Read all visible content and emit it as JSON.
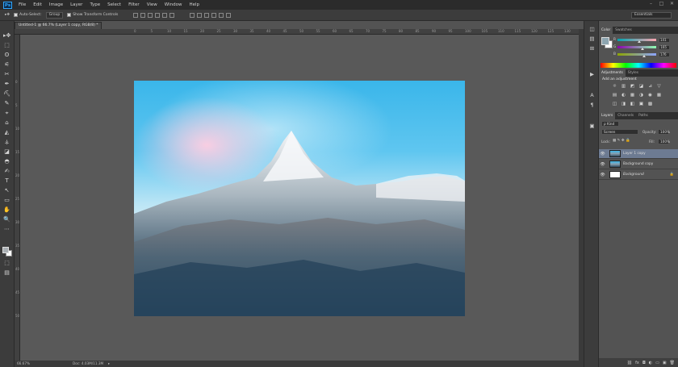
{
  "app": {
    "logo": "Ps"
  },
  "menu": [
    "File",
    "Edit",
    "Image",
    "Layer",
    "Type",
    "Select",
    "Filter",
    "View",
    "Window",
    "Help"
  ],
  "window_controls": [
    "–",
    "□",
    "✕"
  ],
  "options": {
    "move_tool_icon": "▸✥",
    "auto_select_label": "Auto-Select:",
    "auto_select_value": "Group",
    "transform_label": "Show Transform Controls",
    "workspace": "Essentials"
  },
  "document": {
    "tab_title": "Untitled-1 @ 66.7% (Layer 1 copy, RGB/8) *",
    "zoom": "66.67%",
    "doc_size": "Doc: 4.03M/11.3M",
    "status_arrow": "▸"
  },
  "rulers": {
    "top": [
      "0",
      "5",
      "10",
      "15",
      "20",
      "25",
      "30",
      "35",
      "40",
      "45",
      "50",
      "55",
      "60",
      "65",
      "70",
      "75",
      "80",
      "85",
      "90",
      "95",
      "100",
      "105",
      "110",
      "115",
      "120",
      "125",
      "130"
    ],
    "left": [
      "0",
      "5",
      "10",
      "15",
      "20",
      "25",
      "30",
      "35",
      "40",
      "45",
      "50"
    ]
  },
  "panels": {
    "color": {
      "tabs": [
        "Color",
        "Swatches"
      ],
      "r": {
        "label": "R",
        "value": "141",
        "fraction": 0.553
      },
      "g": {
        "label": "G",
        "value": "165",
        "fraction": 0.647
      },
      "b": {
        "label": "B",
        "value": "176",
        "fraction": 0.69
      },
      "fg_color": "#8da5b0"
    },
    "adjustments": {
      "tabs": [
        "Adjustments",
        "Styles"
      ],
      "heading": "Add an adjustment",
      "row1": [
        "☼",
        "▥",
        "◩",
        "◪",
        "⊿",
        "▽"
      ],
      "row2": [
        "▤",
        "◐",
        "▦",
        "◑",
        "◉",
        "▦"
      ],
      "row3": [
        "◫",
        "◨",
        "◧",
        "▣",
        "▩"
      ]
    },
    "layers": {
      "tabs": [
        "Layers",
        "Channels",
        "Paths"
      ],
      "kind": "ρ Kind",
      "blend_mode": "Screen",
      "opacity_label": "Opacity:",
      "opacity_value": "100%",
      "lock_label": "Lock:",
      "lock_icons": "▦ ✎ ✥ 🔒",
      "fill_label": "Fill:",
      "fill_value": "100%",
      "items": [
        {
          "name": "Layer 1 copy"
        },
        {
          "name": "Background copy"
        },
        {
          "name": "Background"
        }
      ],
      "visible_icon": "👁",
      "lock_icon": "🔒",
      "footer": [
        "⛓",
        "fx",
        "◘",
        "◐",
        "▭",
        "▣",
        "🗑"
      ]
    }
  },
  "tools": [
    "▸✥",
    "⬚",
    "ʘ",
    "⚟",
    "✂",
    "✒",
    "⛏",
    "✎",
    "⌖",
    "⌂",
    "◭",
    "⚶",
    "◪",
    "◓",
    "✍",
    "T",
    "↖",
    "▭",
    "✋",
    "🔍",
    "⋯",
    "⬚",
    "▤"
  ],
  "dock": [
    "◫",
    "▤",
    "⊞",
    "▶",
    "A",
    "¶",
    "▣"
  ]
}
